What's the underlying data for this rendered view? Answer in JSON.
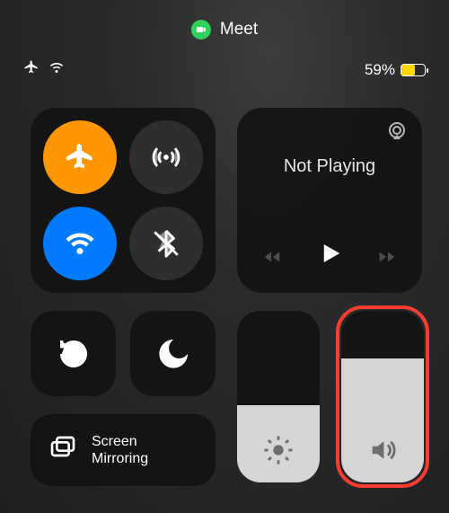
{
  "app": {
    "name": "Meet",
    "indicator_color": "#30d158"
  },
  "status": {
    "airplane_mode": true,
    "wifi_connected": true,
    "battery_percent_label": "59%",
    "battery_percent_value": 59,
    "battery_fill_color": "#ffd60a"
  },
  "connectivity": {
    "airplane": {
      "active": true,
      "bg": "#ff9500"
    },
    "cellular": {
      "active": false
    },
    "wifi": {
      "active": true,
      "bg": "#007aff"
    },
    "bluetooth": {
      "active": false,
      "slashed": true
    }
  },
  "media": {
    "title": "Not Playing",
    "playing": false
  },
  "toggles": {
    "rotation_lock": true,
    "do_not_disturb": true
  },
  "mirror_label": "Screen\nMirroring",
  "sliders": {
    "brightness_percent": 45,
    "volume_percent": 72
  },
  "highlight_target": "volume-slider"
}
